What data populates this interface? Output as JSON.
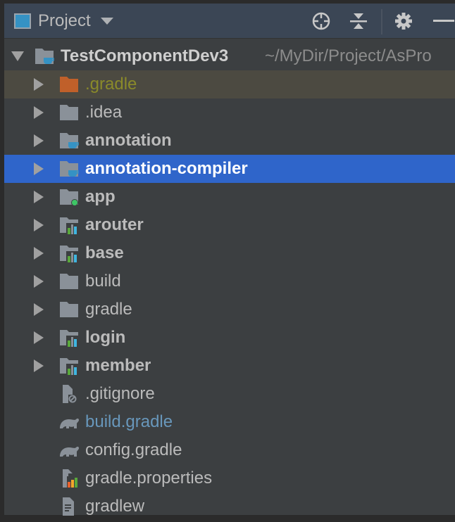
{
  "header": {
    "title": "Project",
    "icons": [
      "project-view-icon",
      "dropdown-icon",
      "locate-icon",
      "collapse-all-icon",
      "gear-icon",
      "minimize-icon"
    ]
  },
  "root": {
    "name": "TestComponentDev3",
    "path": "~/MyDir/Project/AsPro"
  },
  "items": [
    {
      "label": ".gradle",
      "icon": "folder-excluded",
      "expandable": true,
      "bold": false,
      "color": "#8a8a2a"
    },
    {
      "label": ".idea",
      "icon": "folder",
      "expandable": true,
      "bold": false
    },
    {
      "label": "annotation",
      "icon": "folder-java-module",
      "expandable": true,
      "bold": true
    },
    {
      "label": "annotation-compiler",
      "icon": "folder-java-module",
      "expandable": true,
      "bold": true,
      "selected": true
    },
    {
      "label": "app",
      "icon": "folder-android-app",
      "expandable": true,
      "bold": true
    },
    {
      "label": "arouter",
      "icon": "folder-library-module",
      "expandable": true,
      "bold": true
    },
    {
      "label": "base",
      "icon": "folder-library-module",
      "expandable": true,
      "bold": true
    },
    {
      "label": "build",
      "icon": "folder",
      "expandable": true,
      "bold": false
    },
    {
      "label": "gradle",
      "icon": "folder",
      "expandable": true,
      "bold": false
    },
    {
      "label": "login",
      "icon": "folder-library-module",
      "expandable": true,
      "bold": true
    },
    {
      "label": "member",
      "icon": "folder-library-module",
      "expandable": true,
      "bold": true
    },
    {
      "label": ".gitignore",
      "icon": "gitignore-file",
      "expandable": false,
      "bold": false
    },
    {
      "label": "build.gradle",
      "icon": "gradle-file",
      "expandable": false,
      "bold": false,
      "color": "#6897bb"
    },
    {
      "label": "config.gradle",
      "icon": "gradle-file",
      "expandable": false,
      "bold": false
    },
    {
      "label": "gradle.properties",
      "icon": "properties-file",
      "expandable": false,
      "bold": false
    },
    {
      "label": "gradlew",
      "icon": "text-file",
      "expandable": false,
      "bold": false
    }
  ],
  "colors": {
    "selection": "#2f65ca",
    "ignored_bg": "#4c4a41",
    "header_bg": "#3b4655",
    "panel_bg": "#3c3f41"
  }
}
